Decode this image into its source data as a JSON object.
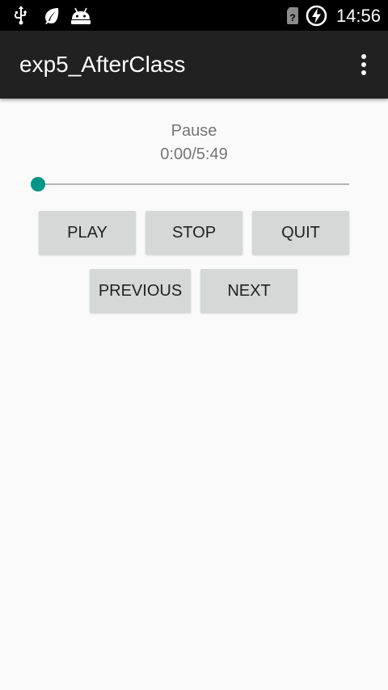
{
  "status_bar": {
    "left_icons": [
      "usb-icon",
      "leaf-icon",
      "android-debug-icon"
    ],
    "right_icons": [
      "no-sim-icon",
      "battery-charging-icon"
    ],
    "time": "14:56"
  },
  "app_bar": {
    "title": "exp5_AfterClass",
    "menu_icon": "more-vert-icon",
    "background": "#212121"
  },
  "player": {
    "state": "Pause",
    "time": "0:00/5:49",
    "progress": 0
  },
  "buttons": {
    "play": "PLAY",
    "stop": "STOP",
    "quit": "QUIT",
    "previous": "PREVIOUS",
    "next": "NEXT"
  },
  "colors": {
    "accent": "#009688",
    "button_bg": "#d6d7d7",
    "page_bg": "#fafafa",
    "secondary_text": "#757575"
  }
}
